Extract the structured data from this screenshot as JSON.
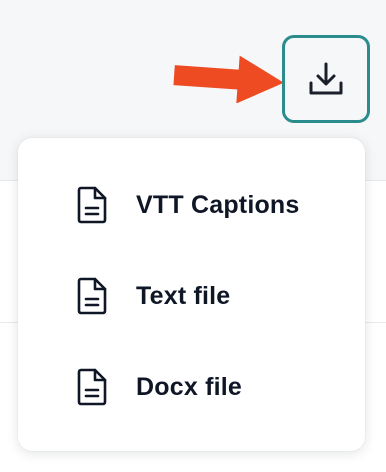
{
  "colors": {
    "accent_border": "#2a8c8c",
    "arrow": "#ee4b23",
    "text": "#0f1726"
  },
  "download_button": {
    "icon": "download-icon"
  },
  "export_menu": {
    "items": [
      {
        "label": "VTT Captions",
        "icon": "document-icon"
      },
      {
        "label": "Text file",
        "icon": "document-icon"
      },
      {
        "label": "Docx file",
        "icon": "document-icon"
      }
    ]
  }
}
